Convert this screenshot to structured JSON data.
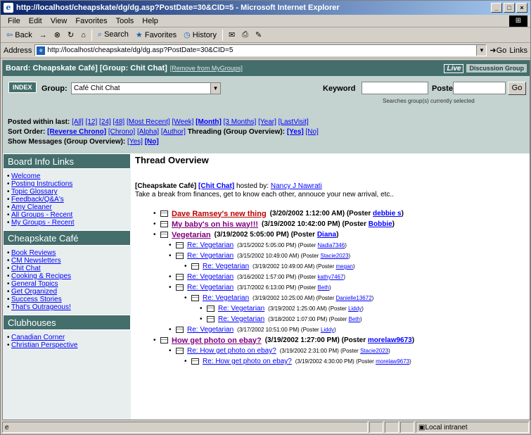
{
  "window": {
    "title": "http://localhost/cheapskate/dg/dg.asp?PostDate=30&CID=5 - Microsoft Internet Explorer",
    "min": "_",
    "max": "□",
    "close": "×"
  },
  "menu": [
    "File",
    "Edit",
    "View",
    "Favorites",
    "Tools",
    "Help"
  ],
  "toolbar": {
    "back": "Back",
    "forward": "→",
    "stop": "⊗",
    "refresh": "↻",
    "home": "⌂",
    "search": "Search",
    "favorites": "Favorites",
    "history": "History"
  },
  "address": {
    "label": "Address",
    "value": "http://localhost/cheapskate/dg/dg.asp?PostDate=30&CID=5",
    "go": "Go",
    "links": "Links"
  },
  "header": {
    "title": "Board: Cheapskate Café] [Group: Chit Chat]",
    "remove": "[Remove from MyGroups]",
    "brand_live": "Live",
    "brand_dg": "Discussion Group"
  },
  "filter": {
    "index": "INDEX",
    "group_label": "Group:",
    "group_value": "Café Chit Chat",
    "keyword_label": "Keyword",
    "poster_label": "Poster",
    "go": "Go",
    "search_note": "Searches group(s) currently selected",
    "posted_label": "Posted within last:",
    "posted_opts": [
      "[All]",
      "[12]",
      "[24]",
      "[48]",
      "[Most Recent]",
      "[Week]",
      "[Month]",
      "[3 Months]",
      "[Year]",
      "[LastVisit]"
    ],
    "sort_label": "Sort Order:",
    "sort_opts": [
      "[Reverse Chrono]",
      "[Chrono]",
      "[Alpha]",
      "[Author]"
    ],
    "threading_label": "Threading (Group Overview):",
    "threading_opts": [
      "[Yes]",
      "[No]"
    ],
    "show_label": "Show Messages (Group Overview):",
    "show_opts": [
      "[Yes]",
      "[No]"
    ]
  },
  "sidebar": [
    {
      "head": "Board Info Links",
      "items": [
        "Welcome",
        "Posting Instructions",
        "Topic Glossary",
        "Feedback/Q&A's",
        "Amy Cleaner",
        "All Groups - Recent",
        "My Groups - Recent"
      ]
    },
    {
      "head": "Cheapskate Café",
      "items": [
        "Book Reviews",
        "CM Newsletters",
        "Chit Chat",
        "Cooking & Recipes",
        "General Topics",
        "Get Organized",
        "Success Stories",
        "That's Outrageous!"
      ]
    },
    {
      "head": "Clubhouses",
      "items": [
        "Canadian Corner",
        "Christian Perspective"
      ]
    }
  ],
  "main": {
    "title": "Thread Overview",
    "board": "[Cheapskate Café]",
    "group": "[Chit Chat]",
    "hosted": "hosted by:",
    "host": "Nancy J Nawrati",
    "desc": "Take a break from finances, get to know each other, annouce your new arrival, etc.."
  },
  "threads": [
    {
      "title": "Dave Ramsey's new thing",
      "date": "(3/20/2002 1:12:00 AM)",
      "poster": "debbie s"
    },
    {
      "title": "My baby's on his way!!!",
      "date": "(3/19/2002 10:42:00 PM)",
      "poster": "Bobbie"
    },
    {
      "title": "Vegetarian",
      "date": "(3/19/2002 5:05:00 PM)",
      "poster": "Diana"
    },
    {
      "title": "Re: Vegetarian",
      "date": "(3/15/2002 5:05:00 PM)",
      "poster": "Nadia7346"
    },
    {
      "title": "Re: Vegetarian",
      "date": "(3/15/2002 10:49:00 AM)",
      "poster": "Stacie2023"
    },
    {
      "title": "Re: Vegetarian",
      "date": "(3/19/2002 10:49:00 AM)",
      "poster": "megan"
    },
    {
      "title": "Re: Vegetarian",
      "date": "(3/16/2002 1:57:00 PM)",
      "poster": "kathy7467"
    },
    {
      "title": "Re: Vegetarian",
      "date": "(3/17/2002 6:13:00 PM)",
      "poster": "Beth"
    },
    {
      "title": "Re: Vegetarian",
      "date": "(3/19/2002 10:25:00 AM)",
      "poster": "Danielle13672"
    },
    {
      "title": "Re: Vegetarian",
      "date": "(3/19/2002 1:25:00 AM)",
      "poster": "Liddy"
    },
    {
      "title": "Re: Vegetarian",
      "date": "(3/18/2002 1:07:00 PM)",
      "poster": "Beth"
    },
    {
      "title": "Re: Vegetarian",
      "date": "(3/17/2002 10:51:00 PM)",
      "poster": "Liddy"
    },
    {
      "title": "How get photo on ebay?",
      "date": "(3/19/2002 1:27:00 PM)",
      "poster": "morelaw9673"
    },
    {
      "title": "Re: How get photo on ebay?",
      "date": "(3/19/2002 2:31:00 PM)",
      "poster": "Stacie2023"
    },
    {
      "title": "Re: How get photo on ebay?",
      "date": "(3/19/2002 4:30:00 PM)",
      "poster": "morelaw9673"
    }
  ],
  "poster_prefix": "(Poster",
  "poster_suffix": ")",
  "status": {
    "zone": "Local intranet",
    "icon": "e"
  }
}
